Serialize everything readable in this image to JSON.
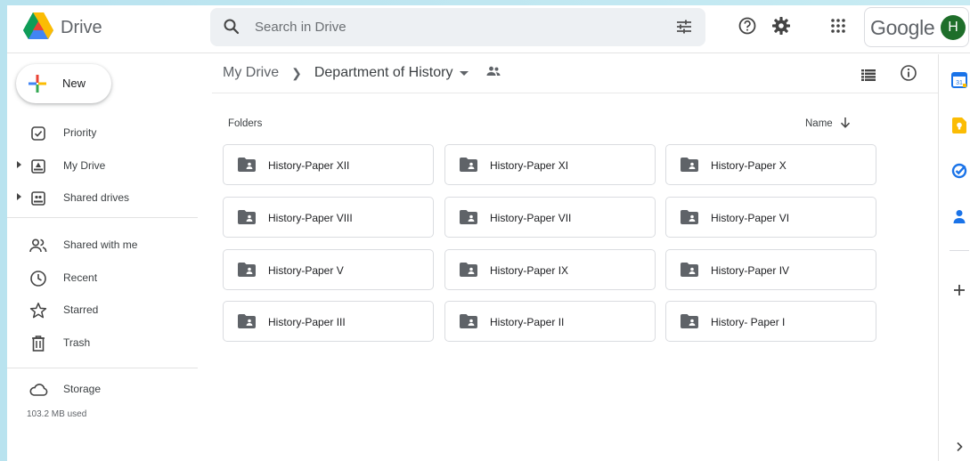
{
  "header": {
    "app_name": "Drive",
    "search_placeholder": "Search in Drive",
    "account_brand": "Google",
    "avatar_initial": "H",
    "icons": [
      "drive-logo-icon",
      "search-icon",
      "tune-icon",
      "help-icon",
      "gear-icon",
      "apps-grid-icon"
    ]
  },
  "sidebar": {
    "new_label": "New",
    "items": [
      {
        "label": "Priority",
        "icon": "priority-check-icon"
      },
      {
        "label": "My Drive",
        "icon": "my-drive-icon"
      },
      {
        "label": "Shared drives",
        "icon": "shared-drives-icon"
      },
      {
        "label": "Shared with me",
        "icon": "people-icon"
      },
      {
        "label": "Recent",
        "icon": "clock-icon"
      },
      {
        "label": "Starred",
        "icon": "star-icon"
      },
      {
        "label": "Trash",
        "icon": "trash-icon"
      },
      {
        "label": "Storage",
        "icon": "cloud-icon"
      }
    ],
    "storage_used": "103.2 MB used"
  },
  "main": {
    "breadcrumb": {
      "root": "My Drive",
      "current": "Department of History"
    },
    "section_label": "Folders",
    "sort_label": "Name",
    "folders": [
      "History-Paper XII",
      "History-Paper XI",
      "History-Paper X",
      "History-Paper VIII",
      "History-Paper VII",
      "History-Paper VI",
      "History-Paper V",
      "History-Paper IX",
      "History-Paper IV",
      "History-Paper III",
      "History-Paper II",
      "History- Paper I"
    ]
  },
  "side_panel": {
    "icons": [
      "calendar-icon",
      "keep-icon",
      "tasks-icon",
      "contacts-icon",
      "add-icon",
      "chevron-right-icon"
    ],
    "calendar_day": "31"
  },
  "colors": {
    "accent_blue": "#1a73e8",
    "keep_yellow": "#fbbc04",
    "avatar_green": "#1e6e2a",
    "folder_gray": "#5f6368"
  }
}
